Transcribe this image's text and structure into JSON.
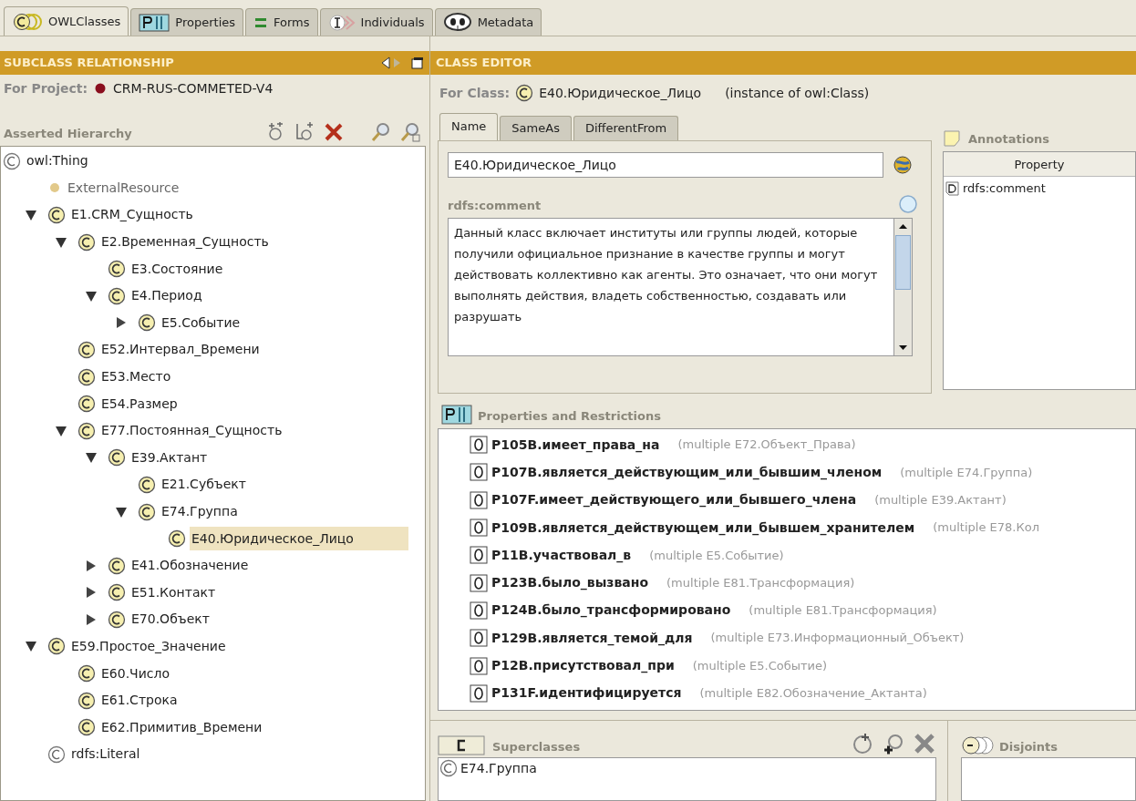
{
  "top_tabs": [
    {
      "label": "OWLClasses",
      "selected": true
    },
    {
      "label": "Properties",
      "selected": false
    },
    {
      "label": "Forms",
      "selected": false
    },
    {
      "label": "Individuals",
      "selected": false
    },
    {
      "label": "Metadata",
      "selected": false
    }
  ],
  "left_panel": {
    "title": "SUBCLASS RELATIONSHIP",
    "project_label": "For Project:",
    "project_name": "CRM-RUS-COMMETED-V4",
    "hierarchy_label": "Asserted Hierarchy",
    "tree": [
      {
        "label": "owl:Thing",
        "kind": "builtin",
        "selected": false,
        "children": [
          {
            "label": "ExternalResource",
            "kind": "resource",
            "selected": false
          },
          {
            "label": "E1.CRM_Сущность",
            "kind": "class",
            "selected": false,
            "expanded": true,
            "children": [
              {
                "label": "E2.Временная_Сущность",
                "kind": "class",
                "selected": false,
                "expanded": true,
                "children": [
                  {
                    "label": "E3.Состояние",
                    "kind": "class",
                    "selected": false
                  },
                  {
                    "label": "E4.Период",
                    "kind": "class",
                    "selected": false,
                    "expanded": true,
                    "children": [
                      {
                        "label": "E5.Событие",
                        "kind": "class",
                        "selected": false,
                        "expanded": false
                      }
                    ]
                  }
                ]
              },
              {
                "label": "E52.Интервал_Времени",
                "kind": "class",
                "selected": false
              },
              {
                "label": "E53.Место",
                "kind": "class",
                "selected": false
              },
              {
                "label": "E54.Размер",
                "kind": "class",
                "selected": false
              },
              {
                "label": "E77.Постоянная_Сущность",
                "kind": "class",
                "selected": false,
                "expanded": true,
                "children": [
                  {
                    "label": "E39.Актант",
                    "kind": "class",
                    "selected": false,
                    "expanded": true,
                    "children": [
                      {
                        "label": "E21.Субъект",
                        "kind": "class",
                        "selected": false
                      },
                      {
                        "label": "E74.Группа",
                        "kind": "class",
                        "selected": false,
                        "expanded": true,
                        "children": [
                          {
                            "label": "E40.Юридическое_Лицо",
                            "kind": "class",
                            "selected": true
                          }
                        ]
                      }
                    ]
                  },
                  {
                    "label": "E41.Обозначение",
                    "kind": "class",
                    "selected": false,
                    "expanded": false
                  },
                  {
                    "label": "E51.Контакт",
                    "kind": "class",
                    "selected": false,
                    "expanded": false
                  },
                  {
                    "label": "E70.Объект",
                    "kind": "class",
                    "selected": false,
                    "expanded": false
                  }
                ]
              }
            ]
          },
          {
            "label": "E59.Простое_Значение",
            "kind": "class",
            "selected": false,
            "expanded": true,
            "children": [
              {
                "label": "E60.Число",
                "kind": "class",
                "selected": false
              },
              {
                "label": "E61.Строка",
                "kind": "class",
                "selected": false
              },
              {
                "label": "E62.Примитив_Времени",
                "kind": "class",
                "selected": false
              }
            ]
          },
          {
            "label": "rdfs:Literal",
            "kind": "builtin",
            "selected": false
          }
        ]
      }
    ]
  },
  "class_editor": {
    "title": "CLASS EDITOR",
    "for_label": "For Class:",
    "class_name": "E40.Юридическое_Лицо",
    "instance_of": "(instance of owl:Class)",
    "tabs": [
      {
        "label": "Name",
        "selected": true
      },
      {
        "label": "SameAs",
        "selected": false
      },
      {
        "label": "DifferentFrom",
        "selected": false
      }
    ],
    "name_value": "E40.Юридическое_Лицо",
    "comment_label": "rdfs:comment",
    "comment": "Данный класс включает институты или группы людей, которые получили официальное признание в качестве группы и могут действовать коллективно как агенты. Это означает, что они могут выполнять действия, владеть собственностью, создавать или разрушать",
    "annotations": {
      "title": "Annotations",
      "column": "Property",
      "rows": [
        "rdfs:comment"
      ]
    },
    "properties": {
      "title": "Properties and Restrictions",
      "items": [
        {
          "name": "P105B.имеет_права_на",
          "range": "(multiple E72.Объект_Права)"
        },
        {
          "name": "P107B.является_действующим_или_бывшим_членом",
          "range": "(multiple E74.Группа)"
        },
        {
          "name": "P107F.имеет_действующего_или_бывшего_члена",
          "range": "(multiple E39.Актант)"
        },
        {
          "name": "P109B.является_действующем_или_бывшем_хранителем",
          "range": "(multiple E78.Кол"
        },
        {
          "name": "P11B.участвовал_в",
          "range": "(multiple E5.Событие)"
        },
        {
          "name": "P123B.было_вызвано",
          "range": "(multiple E81.Трансформация)"
        },
        {
          "name": "P124B.было_трансформировано",
          "range": "(multiple E81.Трансформация)"
        },
        {
          "name": "P129B.является_темой_для",
          "range": "(multiple E73.Информационный_Объект)"
        },
        {
          "name": "P12B.присутствовал_при",
          "range": "(multiple E5.Событие)"
        },
        {
          "name": "P131F.идентифицируется",
          "range": "(multiple E82.Обозначение_Актанта)"
        }
      ]
    },
    "superclasses": {
      "title": "Superclasses",
      "items": [
        "E74.Группа"
      ]
    },
    "disjoints": {
      "title": "Disjoints"
    }
  }
}
